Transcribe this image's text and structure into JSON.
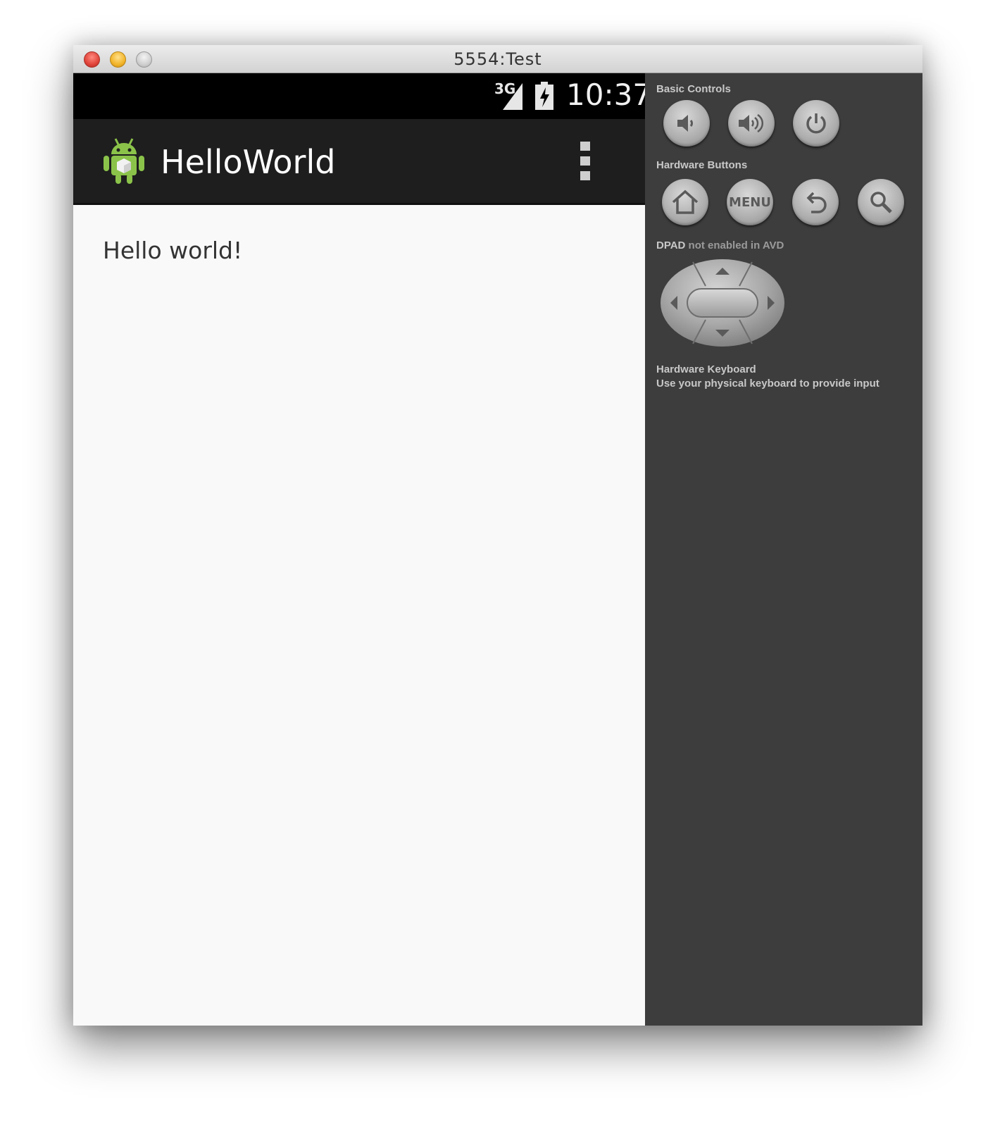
{
  "window": {
    "title": "5554:Test"
  },
  "status_bar": {
    "network": "3G",
    "time": "10:37"
  },
  "action_bar": {
    "app_title": "HelloWorld"
  },
  "content": {
    "text": "Hello world!"
  },
  "controls": {
    "basic_controls_label": "Basic Controls",
    "hardware_buttons_label": "Hardware Buttons",
    "menu_label": "MENU",
    "dpad_label_strong": "DPAD",
    "dpad_label_rest": " not enabled in AVD",
    "keyboard_title": "Hardware Keyboard",
    "keyboard_desc": "Use your physical keyboard to provide input"
  },
  "icons": [
    "close-traffic-light",
    "minimize-traffic-light",
    "maximize-traffic-light",
    "signal-icon",
    "battery-icon",
    "android-icon",
    "overflow-menu-icon",
    "volume-down-icon",
    "volume-up-icon",
    "power-icon",
    "home-icon",
    "back-icon",
    "search-icon",
    "dpad"
  ],
  "colors": {
    "status_bar": "#000000",
    "action_bar": "#1e1e1e",
    "content_bg": "#f9f9f9",
    "panel_bg": "#3d3d3d",
    "android_green": "#8bc34a"
  }
}
